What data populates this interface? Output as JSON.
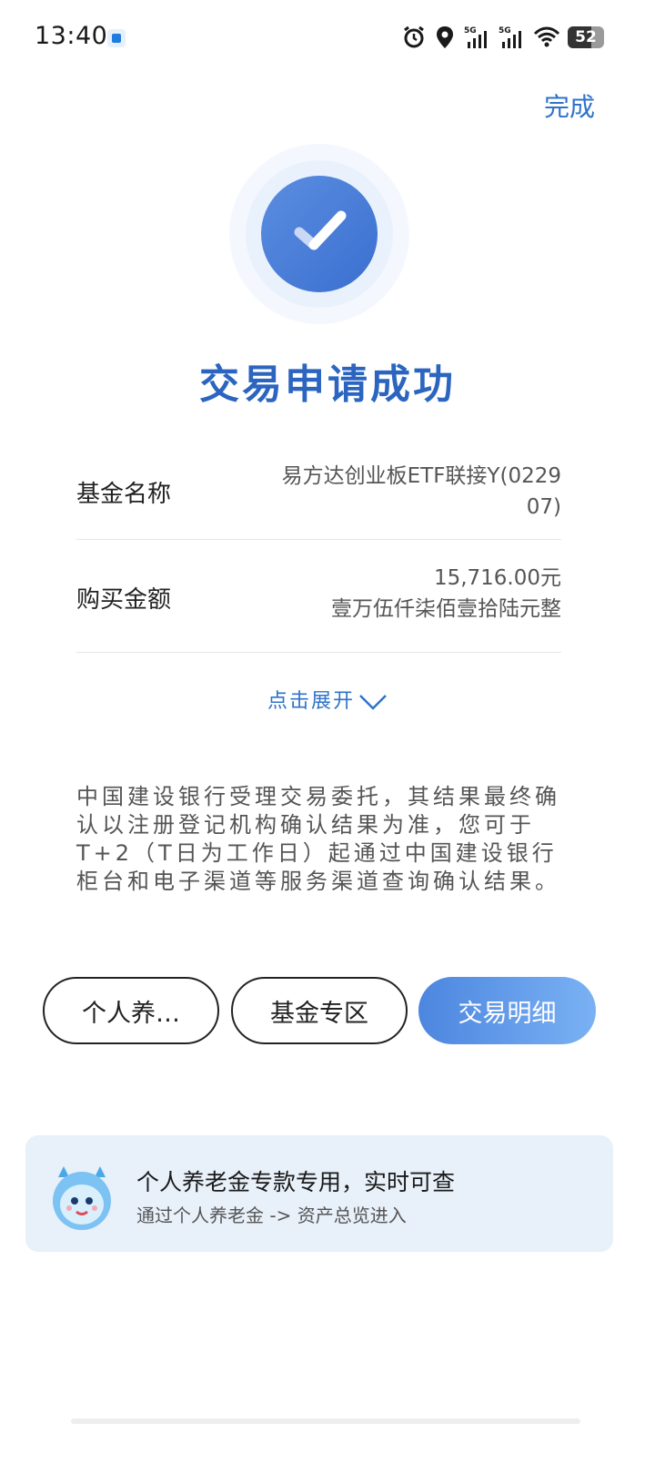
{
  "status_bar": {
    "time": "13:40",
    "battery": "52",
    "icons": [
      "alarm-icon",
      "location-icon",
      "signal-5g-icon",
      "signal-5g-icon",
      "wifi-icon",
      "battery-icon"
    ]
  },
  "header": {
    "done_label": "完成"
  },
  "result": {
    "title": "交易申请成功",
    "icon": "check-icon",
    "color": "#2c65c0"
  },
  "details": [
    {
      "label": "基金名称",
      "value_line1": "易方达创业板ETF联接Y(0229",
      "value_line2": "07)"
    },
    {
      "label": "购买金额",
      "value_line1": "15,716.00元",
      "value_line2": "壹万伍仟柒佰壹拾陆元整"
    }
  ],
  "expand": {
    "label": "点击展开",
    "icon": "chevron-down-icon"
  },
  "notice": "中国建设银行受理交易委托，其结果最终确认以注册登记机构确认结果为准，您可于T+2（T日为工作日）起通过中国建设银行柜台和电子渠道等服务渠道查询确认结果。",
  "actions": [
    {
      "label": "个人养…"
    },
    {
      "label": "基金专区"
    },
    {
      "label": "交易明细"
    }
  ],
  "promo": {
    "title": "个人养老金专款专用，实时可查",
    "subtitle": "通过个人养老金 -> 资产总览进入",
    "avatar": "mascot-avatar"
  },
  "colors": {
    "accent": "#2f73c9",
    "primary_button": "#5b92e6",
    "card_bg": "#e8f0fa"
  }
}
